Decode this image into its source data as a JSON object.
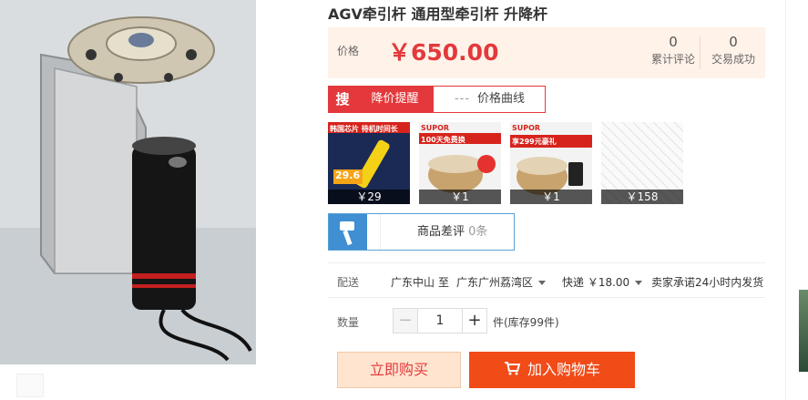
{
  "product": {
    "title": "AGV牵引杆 通用型牵引杆 升降杆",
    "price_label": "价格",
    "price": "￥650.00",
    "stats": [
      {
        "num": "0",
        "label": "累计评论"
      },
      {
        "num": "0",
        "label": "交易成功"
      }
    ]
  },
  "actions": {
    "sou": "搜",
    "price_drop": "降价提醒",
    "price_curve": "价格曲线"
  },
  "thumbs": [
    {
      "price": "￥29",
      "caption": "韩国芯片 待机时间长",
      "sub": "29.6",
      "bg": "#1a2a55"
    },
    {
      "price": "￥1",
      "caption": "SUPOR",
      "sub": "100天免费换",
      "bg": "#f3f3f3"
    },
    {
      "price": "￥1",
      "caption": "SUPOR",
      "sub": "享299元豪礼",
      "bg": "#f3f3f3"
    },
    {
      "price": "￥158",
      "caption": "",
      "sub": "",
      "bg": "#f6f6f6"
    }
  ],
  "review": {
    "label": "商品差评",
    "count": "0条"
  },
  "shipping": {
    "label": "配送",
    "from": "广东中山",
    "to_word": "至",
    "to": "广东广州荔湾区",
    "express": "快递 ￥18.00",
    "promise": "卖家承诺24小时内发货"
  },
  "quantity": {
    "label": "数量",
    "minus": "−",
    "value": "1",
    "plus": "+",
    "stock": "件(库存99件)"
  },
  "buttons": {
    "buy_now": "立即购买",
    "add_cart": "加入购物车"
  },
  "colors": {
    "accent": "#e4393c",
    "cart": "#f14b18",
    "review_blue": "#3f8fd2"
  }
}
